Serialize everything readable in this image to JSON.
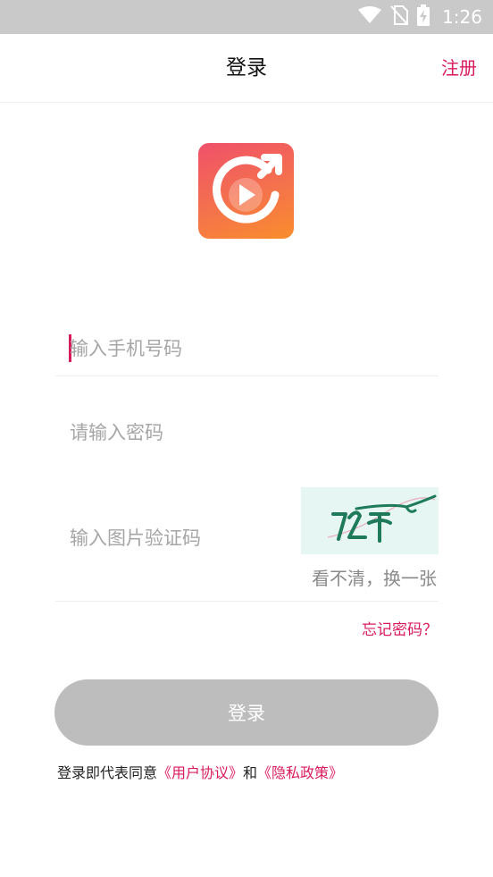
{
  "status_bar": {
    "time": "1:26",
    "icons": [
      "wifi-icon",
      "no-sim-icon",
      "battery-charging-icon"
    ]
  },
  "header": {
    "title": "登录",
    "register_label": "注册"
  },
  "logo": {
    "icon": "replay-video-logo-icon"
  },
  "form": {
    "phone_placeholder": "输入手机号码",
    "password_placeholder": "请输入密码",
    "captcha_placeholder": "输入图片验证码",
    "captcha_refresh_label": "看不清，换一张",
    "forgot_label": "忘记密码？",
    "login_label": "登录"
  },
  "agreement": {
    "prefix": "登录即代表同意",
    "user_agreement": "《用户协议》",
    "and": "和",
    "privacy_policy": "《隐私政策》"
  },
  "colors": {
    "accent": "#d81b5c",
    "status_bar": "#c9c9c9",
    "disabled_button": "#bdbdbd",
    "captcha_bg": "#e6f7f3",
    "logo_gradient": [
      "#f0506a",
      "#f98d2c"
    ]
  }
}
